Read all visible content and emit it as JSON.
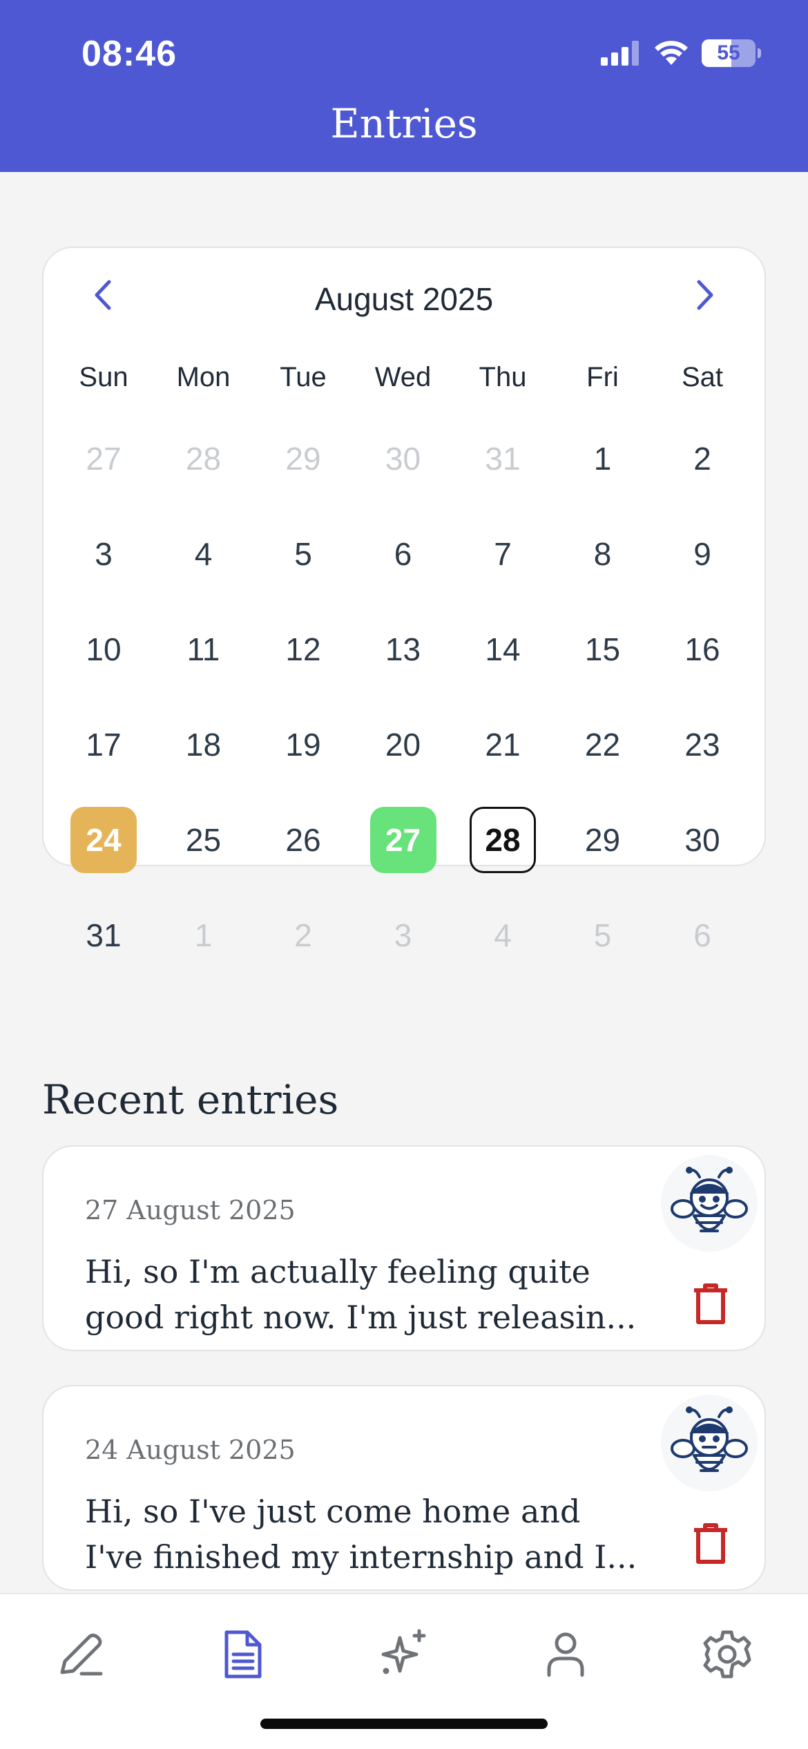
{
  "status_bar": {
    "time": "08:46",
    "battery": "55",
    "battery_level": 0.55
  },
  "header": {
    "title": "Entries"
  },
  "calendar": {
    "month_label": "August 2025",
    "weekdays": [
      "Sun",
      "Mon",
      "Tue",
      "Wed",
      "Thu",
      "Fri",
      "Sat"
    ],
    "weeks": [
      [
        {
          "d": "27",
          "muted": true
        },
        {
          "d": "28",
          "muted": true
        },
        {
          "d": "29",
          "muted": true
        },
        {
          "d": "30",
          "muted": true
        },
        {
          "d": "31",
          "muted": true
        },
        {
          "d": "1"
        },
        {
          "d": "2"
        }
      ],
      [
        {
          "d": "3"
        },
        {
          "d": "4"
        },
        {
          "d": "5"
        },
        {
          "d": "6"
        },
        {
          "d": "7"
        },
        {
          "d": "8"
        },
        {
          "d": "9"
        }
      ],
      [
        {
          "d": "10"
        },
        {
          "d": "11"
        },
        {
          "d": "12"
        },
        {
          "d": "13"
        },
        {
          "d": "14"
        },
        {
          "d": "15"
        },
        {
          "d": "16"
        }
      ],
      [
        {
          "d": "17"
        },
        {
          "d": "18"
        },
        {
          "d": "19"
        },
        {
          "d": "20"
        },
        {
          "d": "21"
        },
        {
          "d": "22"
        },
        {
          "d": "23"
        }
      ],
      [
        {
          "d": "24",
          "mark": "yellow"
        },
        {
          "d": "25"
        },
        {
          "d": "26"
        },
        {
          "d": "27",
          "mark": "green"
        },
        {
          "d": "28",
          "today": true
        },
        {
          "d": "29"
        },
        {
          "d": "30"
        }
      ],
      [
        {
          "d": "31"
        },
        {
          "d": "1",
          "muted": true
        },
        {
          "d": "2",
          "muted": true
        },
        {
          "d": "3",
          "muted": true
        },
        {
          "d": "4",
          "muted": true
        },
        {
          "d": "5",
          "muted": true
        },
        {
          "d": "6",
          "muted": true
        }
      ]
    ]
  },
  "recent": {
    "title": "Recent entries",
    "entries": [
      {
        "date": "27 August 2025",
        "text_line1": "Hi, so I'm actually feeling quite",
        "text_line2": "good right now. I'm just releasin...",
        "mood_icon": "bee-happy-icon"
      },
      {
        "date": "24 August 2025",
        "text_line1": "Hi, so I've just come home and",
        "text_line2": "I've finished my internship and I...",
        "mood_icon": "bee-neutral-icon"
      }
    ]
  },
  "tabs": [
    {
      "name": "write",
      "icon": "pencil-icon",
      "active": false
    },
    {
      "name": "entries",
      "icon": "document-icon",
      "active": true
    },
    {
      "name": "insights",
      "icon": "sparkle-icon",
      "active": false
    },
    {
      "name": "profile",
      "icon": "person-icon",
      "active": false
    },
    {
      "name": "settings",
      "icon": "gear-icon",
      "active": false
    }
  ],
  "colors": {
    "accent": "#4e58d3",
    "mark_yellow": "#e5b458",
    "mark_green": "#68e27a",
    "delete_red": "#c62828",
    "mascot_navy": "#1e3a6e",
    "tab_inactive": "#6f7378"
  }
}
